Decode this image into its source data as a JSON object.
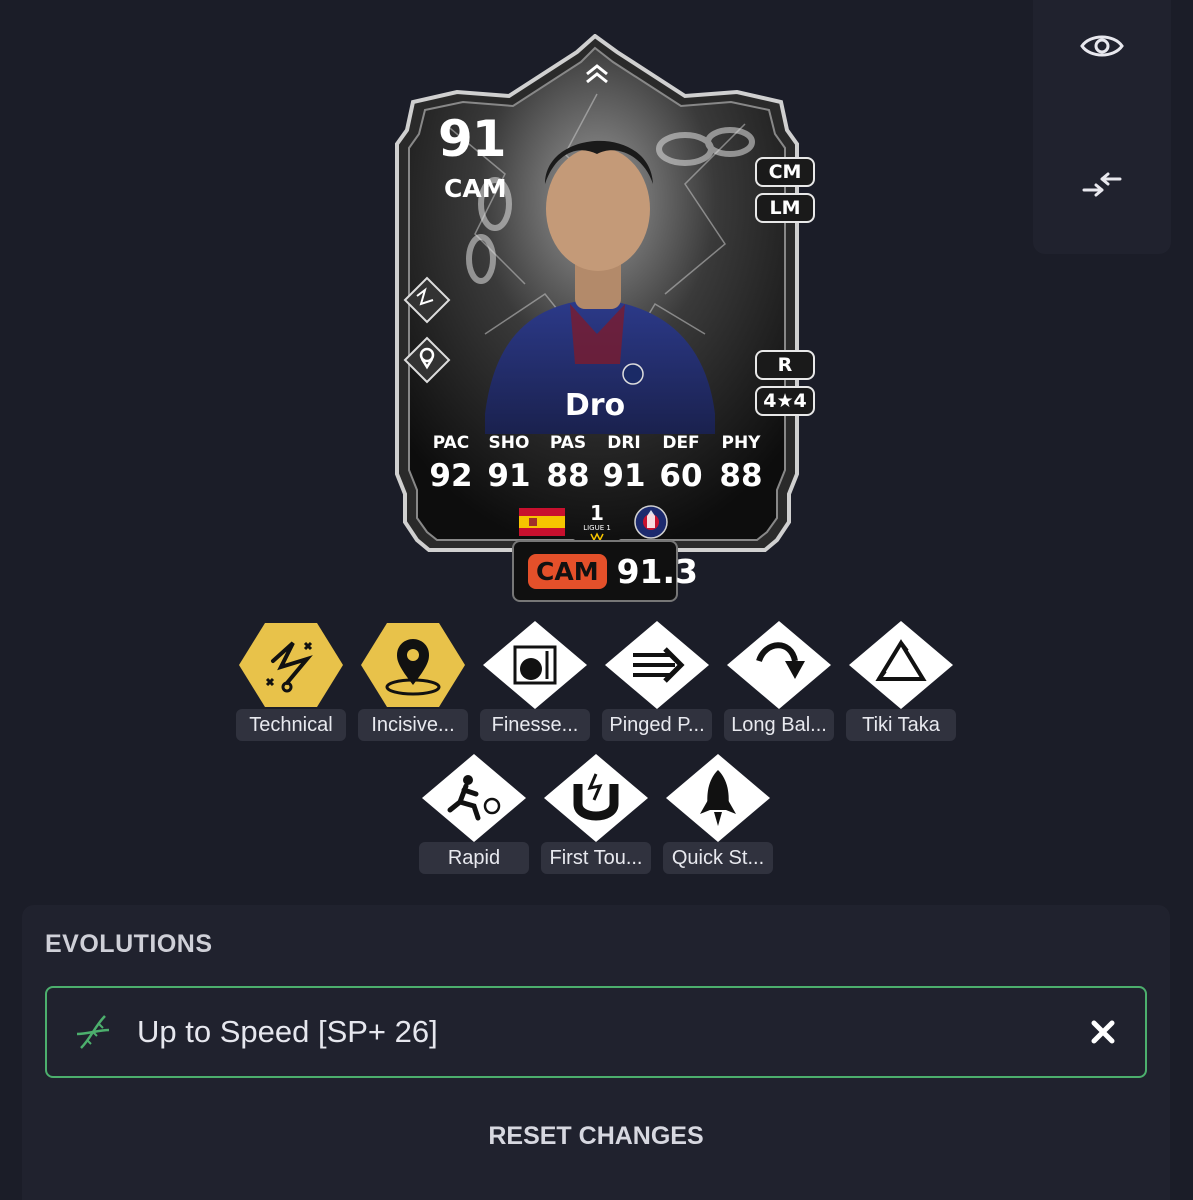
{
  "card": {
    "rating": "91",
    "position": "CAM",
    "alt_positions": [
      "CM",
      "LM"
    ],
    "foot": "R",
    "skill_weak": "4★4",
    "name": "Dro",
    "stats": [
      {
        "label": "PAC",
        "value": "92"
      },
      {
        "label": "SHO",
        "value": "91"
      },
      {
        "label": "PAS",
        "value": "88"
      },
      {
        "label": "DRI",
        "value": "91"
      },
      {
        "label": "DEF",
        "value": "60"
      },
      {
        "label": "PHY",
        "value": "88"
      }
    ],
    "nation_icon": "spain-flag",
    "league_icon": "ligue-1-logo",
    "club_icon": "psg-crest"
  },
  "meta": {
    "position": "CAM",
    "value": "91.3"
  },
  "playstyles": [
    {
      "label": "Technical",
      "icon": "technical-icon",
      "plus": true
    },
    {
      "label": "Incisive...",
      "icon": "location-pin-icon",
      "plus": true
    },
    {
      "label": "Finesse...",
      "icon": "finesse-shot-icon",
      "plus": false
    },
    {
      "label": "Pinged P...",
      "icon": "pinged-pass-icon",
      "plus": false
    },
    {
      "label": "Long Bal...",
      "icon": "long-ball-icon",
      "plus": false
    },
    {
      "label": "Tiki Taka",
      "icon": "tiki-taka-icon",
      "plus": false
    },
    {
      "label": "Rapid",
      "icon": "rapid-icon",
      "plus": false
    },
    {
      "label": "First Tou...",
      "icon": "magnet-icon",
      "plus": false
    },
    {
      "label": "Quick St...",
      "icon": "rocket-icon",
      "plus": false
    }
  ],
  "evolutions": {
    "title": "EVOLUTIONS",
    "items": [
      {
        "name": "Up to Speed [SP+ 26]",
        "icon": "dna-icon"
      }
    ],
    "reset_label": "RESET CHANGES"
  },
  "colors": {
    "background": "#1b1d28",
    "panel": "#20222e",
    "playstyle_plus": "#e8c24a",
    "evolution_border": "#4caf6d",
    "meta_accent": "#e4502a"
  }
}
